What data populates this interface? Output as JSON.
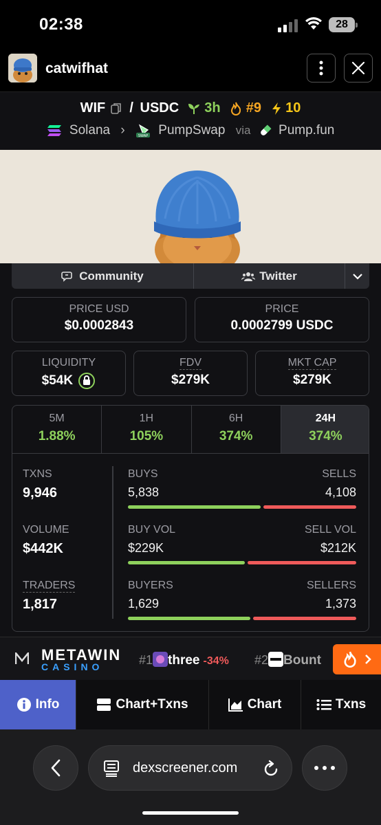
{
  "status_bar": {
    "time": "02:38",
    "battery": "28"
  },
  "header": {
    "title": "catwifhat"
  },
  "pair": {
    "base": "WIF",
    "separator": "/",
    "quote": "USDC",
    "age": "3h",
    "rank": "#9",
    "boosts": "10",
    "chain": "Solana",
    "dex": "PumpSwap",
    "via_label": "via",
    "launchpad": "Pump.fun"
  },
  "links": {
    "community": "Community",
    "twitter": "Twitter"
  },
  "stats": {
    "price_usd_label": "PRICE USD",
    "price_usd": "$0.0002843",
    "price_label": "PRICE",
    "price": "0.0002799 USDC",
    "liquidity_label": "LIQUIDITY",
    "liquidity": "$54K",
    "fdv_label": "FDV",
    "fdv": "$279K",
    "mktcap_label": "MKT CAP",
    "mktcap": "$279K"
  },
  "timeframes": [
    {
      "label": "5M",
      "change": "1.88%"
    },
    {
      "label": "1H",
      "change": "105%"
    },
    {
      "label": "6H",
      "change": "374%"
    },
    {
      "label": "24H",
      "change": "374%"
    }
  ],
  "selected_timeframe": "24H",
  "txn_stats": {
    "txns_label": "TXNS",
    "txns": "9,946",
    "buys_label": "BUYS",
    "buys": "5,838",
    "sells_label": "SELLS",
    "sells": "4,108",
    "volume_label": "VOLUME",
    "volume": "$442K",
    "buy_vol_label": "BUY VOL",
    "buy_vol": "$229K",
    "sell_vol_label": "SELL VOL",
    "sell_vol": "$212K",
    "traders_label": "TRADERS",
    "traders": "1,817",
    "buyers_label": "BUYERS",
    "buyers": "1,629",
    "sellers_label": "SELLERS",
    "sellers": "1,373",
    "buy_share": 0.587,
    "buy_vol_share": 0.519,
    "buyer_share": 0.543
  },
  "ticker": {
    "sponsor_top": "METAWIN",
    "sponsor_bottom": "CASINO",
    "items": [
      {
        "rank": "#1",
        "name": "three",
        "change": "-34%"
      },
      {
        "rank": "#2",
        "name": "Bount"
      }
    ]
  },
  "tabs": [
    {
      "label": "Info",
      "active": true
    },
    {
      "label": "Chart+Txns"
    },
    {
      "label": "Chart"
    },
    {
      "label": "Txns"
    }
  ],
  "browser": {
    "url": "dexscreener.com"
  },
  "colors": {
    "green": "#8ed15c",
    "red": "#ef5a5a",
    "active_tab": "#4e61c9",
    "fire": "#ff6a13"
  }
}
